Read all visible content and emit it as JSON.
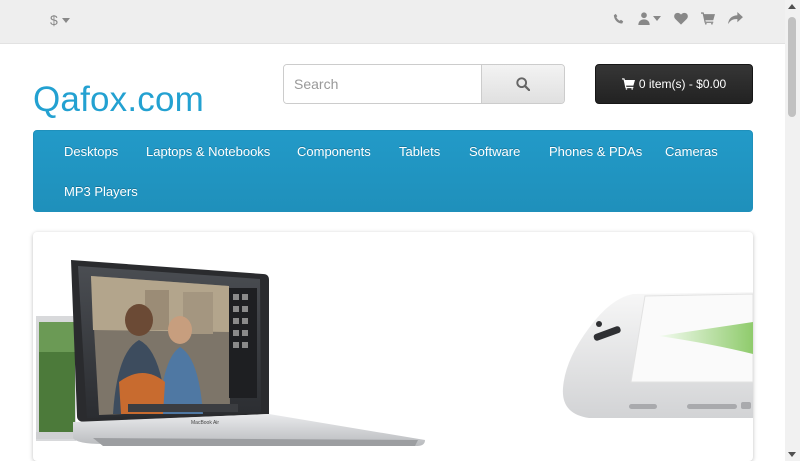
{
  "topbar": {
    "currency_symbol": "$",
    "icons": [
      "phone-icon",
      "user-icon",
      "heart-icon",
      "shopping-cart-icon",
      "share-icon"
    ]
  },
  "header": {
    "logo_text": "Qafox.com",
    "search_placeholder": "Search",
    "cart_label": "0 item(s) - $0.00"
  },
  "menu": {
    "items": [
      "Desktops",
      "Laptops & Notebooks",
      "Components",
      "Tablets",
      "Software",
      "Phones & PDAs",
      "Cameras",
      "MP3 Players"
    ]
  },
  "slider": {
    "laptop_brand": "MacBook Air"
  },
  "colors": {
    "brand": "#23a1d1",
    "menu_bg": "#229ac8",
    "cart_bg": "#363636"
  }
}
